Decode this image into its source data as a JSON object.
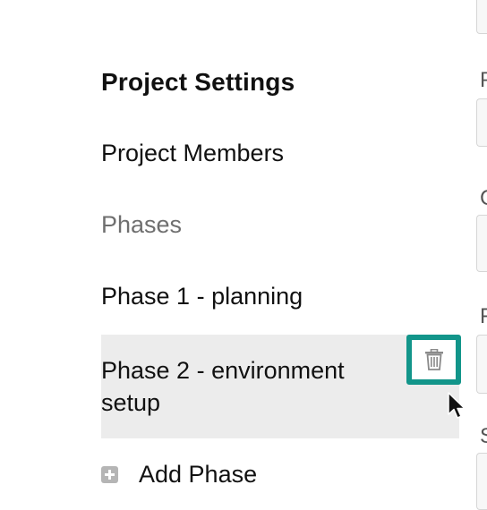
{
  "nav": {
    "heading": "Project Settings",
    "members": "Project Members",
    "phases_label": "Phases",
    "phases": [
      {
        "label": "Phase 1 - planning"
      },
      {
        "label": "Phase 2 - environment setup",
        "selected": true
      }
    ],
    "add_phase": "Add Phase"
  },
  "icons": {
    "delete": "trash-icon",
    "add": "plus-square-icon",
    "cursor": "mouse-pointer-icon"
  },
  "colors": {
    "highlight_border": "#12958a",
    "selected_row_bg": "#ececec",
    "muted_text": "#6f6f6f"
  },
  "form_edge": {
    "letters": [
      "P",
      "C",
      "F",
      "S"
    ]
  }
}
